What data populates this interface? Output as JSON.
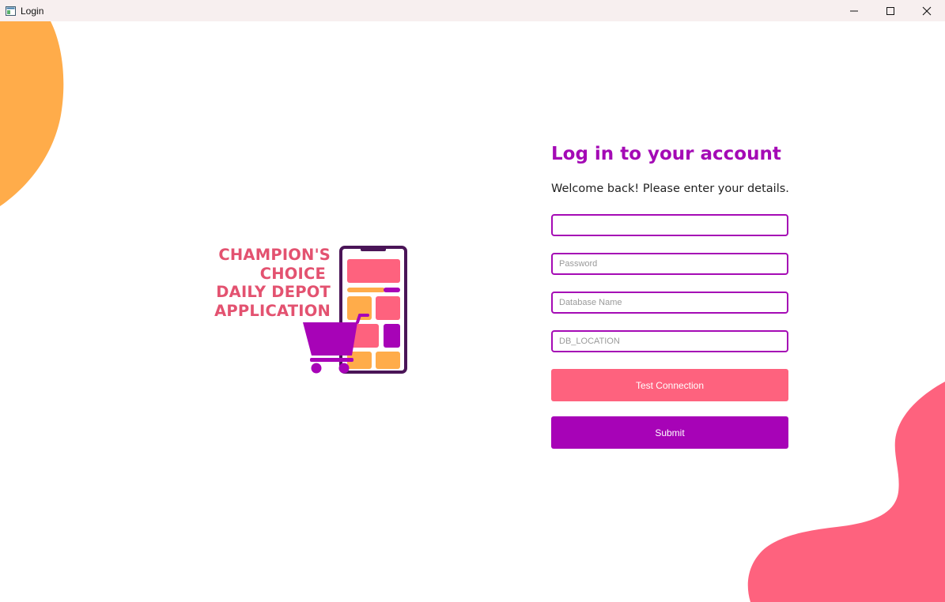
{
  "window": {
    "title": "Login",
    "app_icon": "window-app-icon",
    "controls": [
      "minimize-icon",
      "maximize-icon",
      "close-icon"
    ]
  },
  "logo": {
    "lines": [
      "CHAMPION'S",
      "CHOICE",
      "DAILY DEPOT",
      "APPLICATION"
    ],
    "icon": "phone-shopping-cart-icon"
  },
  "login": {
    "title": "Log in to your account",
    "subtitle": "Welcome back! Please enter your details.",
    "username": {
      "value": "",
      "placeholder": ""
    },
    "password": {
      "value": "",
      "placeholder": "Password"
    },
    "database_name": {
      "value": "",
      "placeholder": "Database Name"
    },
    "db_location": {
      "value": "",
      "placeholder": "DB_LOCATION"
    },
    "test_button_label": "Test Connection",
    "submit_button_label": "Submit"
  },
  "colors": {
    "accent_purple": "#a703b7",
    "accent_pink": "#fe627e",
    "blob_orange": "#ffac4a",
    "blob_pink": "#fe627e",
    "logo_text": "#e35270"
  }
}
